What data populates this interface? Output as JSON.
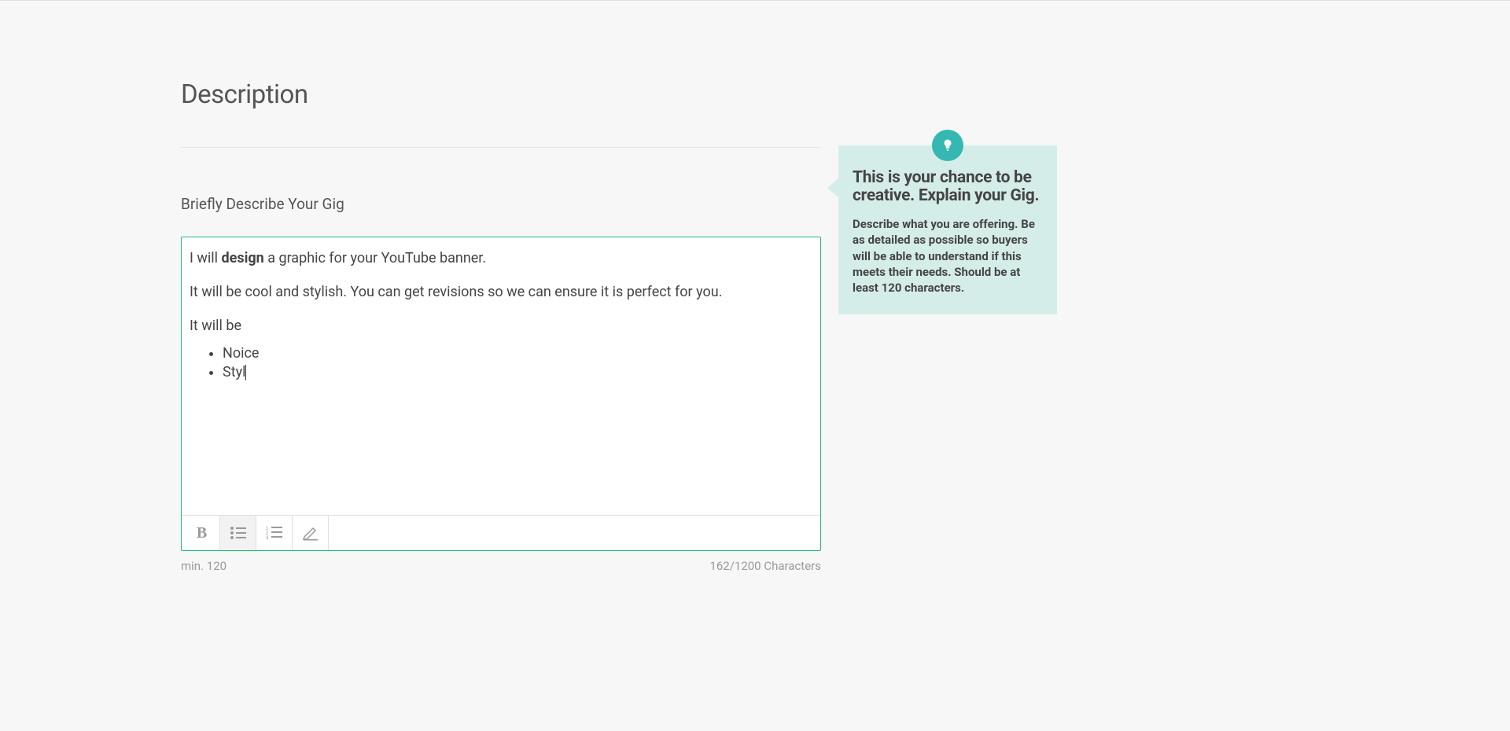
{
  "section": {
    "title": "Description",
    "fieldLabel": "Briefly Describe Your Gig"
  },
  "editor": {
    "line1": {
      "prefix": "I will ",
      "bold": "design",
      "suffix": " a graphic for your YouTube banner."
    },
    "line2": "It will be cool and stylish. You can get revisions so we can ensure it is perfect for you.",
    "line3": "It will be",
    "listItems": [
      "Noice",
      "Styl"
    ]
  },
  "helper": {
    "minText": "min. 120",
    "counter": "162/1200 Characters"
  },
  "tip": {
    "title": "This is your chance to be creative. Explain your Gig.",
    "body": "Describe what you are offering. Be as detailed as possible so buyers will be able to understand if this meets their needs. Should be at least 120 characters."
  }
}
